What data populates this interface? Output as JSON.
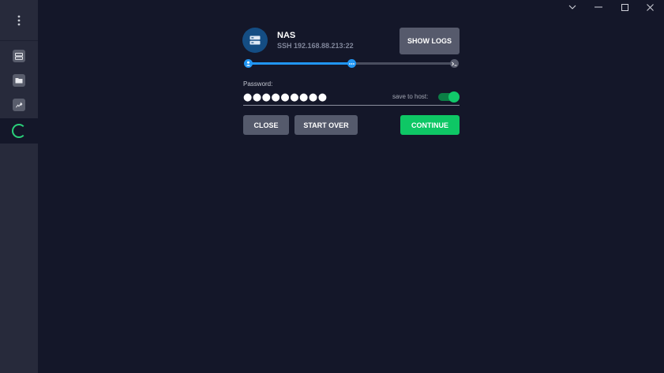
{
  "window_controls": [
    "chevron-down-icon",
    "minimize-icon",
    "maximize-icon",
    "close-icon"
  ],
  "sidebar": {
    "menu_icon": "vertical-dots-icon",
    "items": [
      {
        "icon": "server-icon"
      },
      {
        "icon": "folder-icon"
      },
      {
        "icon": "port-forward-icon"
      }
    ],
    "active_icon": "loading-spinner-icon"
  },
  "host": {
    "name": "NAS",
    "address": "SSH 192.168.88.213:22",
    "icon": "server-icon"
  },
  "buttons": {
    "show_logs": "SHOW LOGS",
    "close": "CLOSE",
    "start_over": "START OVER",
    "continue": "CONTINUE"
  },
  "progress": {
    "current_step": 2,
    "total_steps": 3,
    "steps": [
      {
        "icon": "user-icon"
      },
      {
        "icon": "key-dots-icon"
      },
      {
        "icon": "terminal-icon"
      }
    ]
  },
  "password": {
    "label": "Password:",
    "value": "●●●●●●●●●"
  },
  "save_to_host": {
    "label": "save to host:",
    "enabled": true
  },
  "colors": {
    "background": "#141729",
    "sidebar": "#272a3b",
    "accent_blue": "#2196f3",
    "accent_green": "#0ec765",
    "button_gray": "#555a6c"
  }
}
